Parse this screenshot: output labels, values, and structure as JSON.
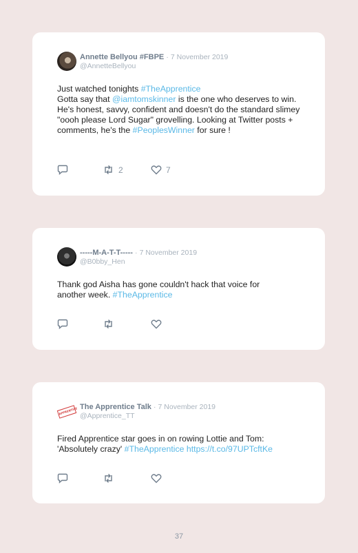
{
  "tweets": [
    {
      "author": "Annette Bellyou #FBPE",
      "separator": "·",
      "date": "7 November 2019",
      "handle": "@AnnetteBellyou",
      "body": {
        "line1_text": "Just watched tonights ",
        "line1_tag": "#TheApprentice",
        "line2_pre": "Gotta say that ",
        "line2_mention": "@iamtomskinner",
        "line2_post": " is the one who deserves to win. He's honest, savvy, confident and doesn't do the standard slimey \"oooh please Lord Sugar\" grovelling. Looking at Twitter posts + comments, he's the ",
        "line2_tag": "#PeoplesWinner",
        "line2_end": " for sure !"
      },
      "retweets": "2",
      "likes": "7"
    },
    {
      "author": "-----M-A-T-T-----",
      "separator": "·",
      "date": "7 November 2019",
      "handle": "@B0bby_Hen",
      "body": {
        "text": "Thank god Aisha has gone couldn't hack that voice for another week. ",
        "tag": "#TheApprentice"
      }
    },
    {
      "author": "The Apprentice Talk",
      "separator": "·",
      "date": "7 November 2019",
      "handle": "@Apprentice_TT",
      "avatar_text": "APPRENTICE",
      "body": {
        "text": "Fired Apprentice star goes in on rowing Lottie and Tom: 'Absolutely crazy' ",
        "tag": "#TheApprentice",
        "space": " ",
        "url": "https://t.co/97UPTcftKe"
      }
    }
  ],
  "page_number": "37",
  "icons": {
    "reply": "reply-icon",
    "retweet": "retweet-icon",
    "like": "heart-icon"
  },
  "colors": {
    "background": "#f1e6e5",
    "link": "#59b8e6",
    "name": "#6f7d8c",
    "meta": "#a9b3bd"
  }
}
